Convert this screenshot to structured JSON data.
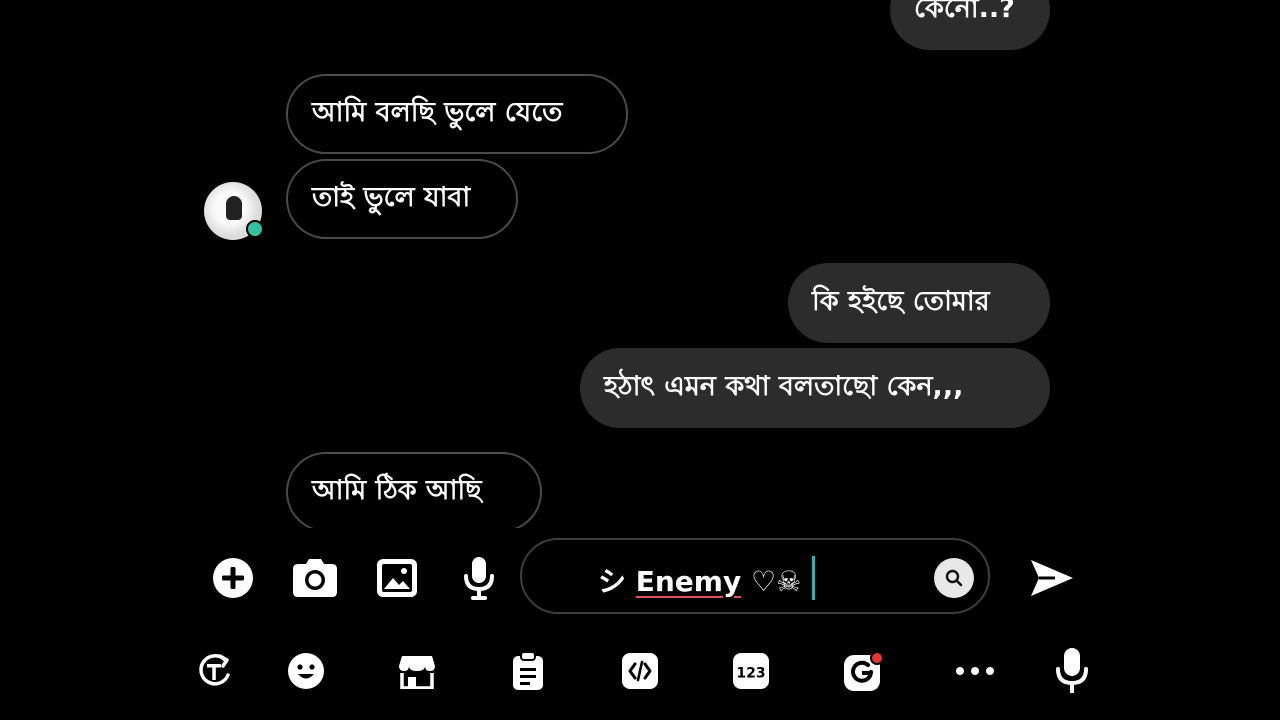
{
  "messages": [
    {
      "text": "কেনো..?",
      "side": "out"
    },
    {
      "text": "আমি বলছি ভুলে যেতে",
      "side": "in"
    },
    {
      "text": "তাই ভুলে যাবা",
      "side": "in"
    },
    {
      "text": "কি হইছে তোমার",
      "side": "out"
    },
    {
      "text": "হঠাৎ এমন কথা বলতাছো কেন,,,",
      "side": "out"
    },
    {
      "text": "আমি ঠিক আছি",
      "side": "in"
    }
  ],
  "composer": {
    "input_value_prefix": "シ ",
    "input_value_main": "Enemy",
    "input_value_suffix": " ♡☠",
    "icons": [
      "plus-icon",
      "camera-icon",
      "image-icon",
      "microphone-icon",
      "search-icon",
      "send-icon"
    ]
  },
  "keyboard_toolbar": {
    "icons": [
      "translate-icon",
      "emoji-icon",
      "store-icon",
      "clipboard-icon",
      "text-editing-icon",
      "numeric-keypad-icon",
      "gboard-settings-icon",
      "more-icon",
      "voice-input-icon"
    ],
    "numeric_label": "123"
  },
  "colors": {
    "background": "#000000",
    "outgoing_bubble": "#2c2c2c",
    "incoming_border": "#4a4a4a",
    "online_dot": "#35c09f",
    "caret": "#2fb6b2",
    "spellcheck_underline": "#e0505a",
    "notification_dot": "#e53935"
  }
}
